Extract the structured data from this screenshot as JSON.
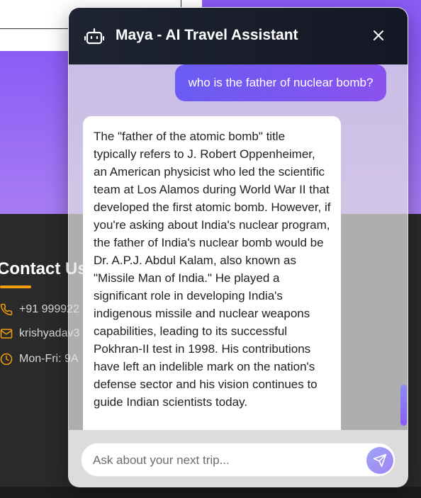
{
  "background": {
    "contact": {
      "title": "Contact Us",
      "phone": "+91 999922",
      "email": "krishyadav3",
      "hours": "Mon-Fri: 9A"
    },
    "colors": {
      "hero": "#8b5cf6",
      "footer": "#2a2a2a",
      "accent": "#f59e0b"
    }
  },
  "chat": {
    "title": "Maya - AI Travel Assistant",
    "header_icon": "robot-icon",
    "close_icon": "close-icon",
    "messages": [
      {
        "role": "user",
        "text": "who is the father of nuclear bomb?"
      },
      {
        "role": "assistant",
        "text": "The \"father of the atomic bomb\" title typically refers to J. Robert Oppenheimer, an American physicist who led the scientific team at Los Alamos during World War II that developed the first atomic bomb. However, if you're asking about India's nuclear program, the father of India's nuclear bomb would be Dr. A.P.J. Abdul Kalam, also known as \"Missile Man of India.\" He played a significant role in developing India's indigenous missile and nuclear weapons capabilities, leading to its successful Pokhran-II test in 1998. His contributions have left an indelible mark on the nation's defense sector and his vision continues to guide Indian scientists today."
      }
    ],
    "input": {
      "value": "",
      "placeholder": "Ask about your next trip..."
    },
    "send_icon": "send-icon",
    "colors": {
      "header": "#1f2433",
      "user_bubble": "#6a5cf3",
      "send_button": "#9aa6f5"
    }
  }
}
